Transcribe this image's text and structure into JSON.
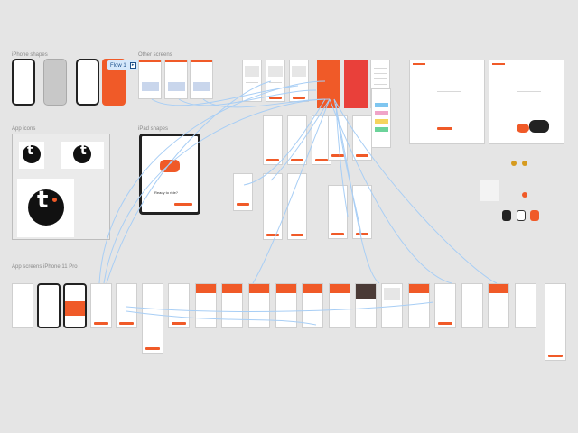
{
  "sections": {
    "iphone_shapes": "iPhone shapes",
    "other_screens": "Other screens",
    "app_icons": "App icons",
    "ipad_shapes": "iPad shapes",
    "app_screens": "App screens iPhone 11 Pro"
  },
  "flow": {
    "label": "Flow 1",
    "icon": "play-icon"
  },
  "ipad": {
    "heading": "Ready to ride?"
  },
  "colors": {
    "accent": "#f05a28",
    "canvas": "#e5e5e5",
    "connector": "#a8cef5",
    "flow_badge": "#d5e8fb"
  }
}
